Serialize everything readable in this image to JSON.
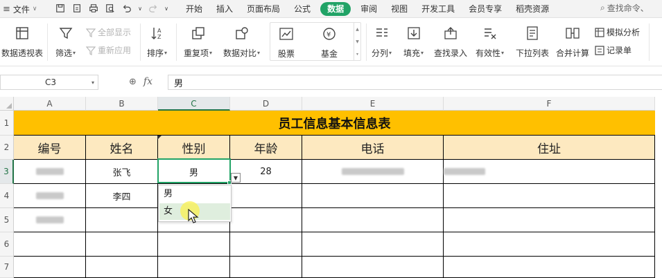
{
  "menubar": {
    "file_label": "文件",
    "tabs": [
      {
        "label": "开始",
        "active": false
      },
      {
        "label": "插入",
        "active": false
      },
      {
        "label": "页面布局",
        "active": false
      },
      {
        "label": "公式",
        "active": false
      },
      {
        "label": "数据",
        "active": true
      },
      {
        "label": "审阅",
        "active": false
      },
      {
        "label": "视图",
        "active": false
      },
      {
        "label": "开发工具",
        "active": false
      },
      {
        "label": "会员专享",
        "active": false
      },
      {
        "label": "稻壳资源",
        "active": false
      }
    ],
    "search_placeholder": "查找命令、",
    "accent_color": "#21a366"
  },
  "ribbon": {
    "pivot_label": "数据透视表",
    "filter_label": "筛选",
    "show_all_label": "全部显示",
    "reapply_label": "重新应用",
    "sort_label": "排序",
    "duplicates_label": "重复项",
    "compare_label": "数据对比",
    "stock_label": "股票",
    "fund_label": "基金",
    "split_label": "分列",
    "fill_label": "填充",
    "lookup_label": "查找录入",
    "validity_label": "有效性",
    "dropdown_list_label": "下拉列表",
    "consolidate_label": "合并计算",
    "simulation_label": "模拟分析",
    "record_label": "记录单"
  },
  "formula_bar": {
    "cell_ref": "C3",
    "fx_label": "fx",
    "value": "男"
  },
  "sheet": {
    "columns": [
      "A",
      "B",
      "C",
      "D",
      "E",
      "F"
    ],
    "selected_column": "C",
    "rows": [
      "1",
      "2",
      "3",
      "4",
      "5",
      "6",
      "7"
    ],
    "selected_row": "3",
    "title": "员工信息基本信息表",
    "title_color": "#ffc000",
    "header_color": "#fde9c0",
    "headers": [
      "编号",
      "姓名",
      "性别",
      "年龄",
      "电话",
      "住址"
    ],
    "data_rows": [
      {
        "name": "张飞",
        "gender": "男",
        "age": "28"
      },
      {
        "name": "李四",
        "gender": "",
        "age": ""
      }
    ]
  },
  "dropdown": {
    "options": [
      "男",
      "女"
    ],
    "hover_index": 1
  }
}
